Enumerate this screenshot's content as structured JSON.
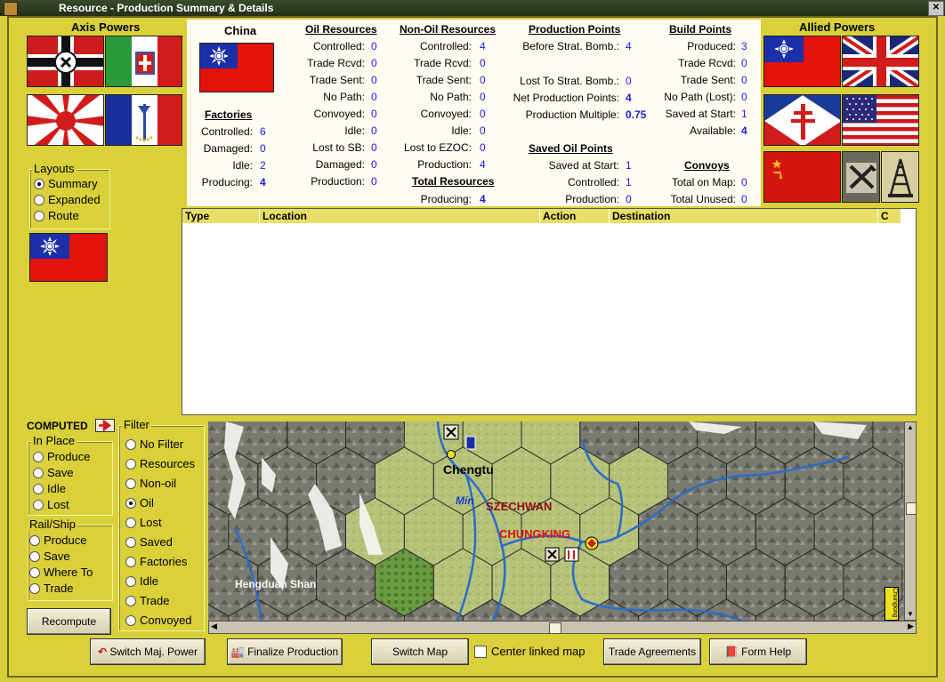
{
  "window": {
    "title": "Resource - Production Summary & Details"
  },
  "axis": {
    "header": "Axis Powers",
    "flags": [
      "Germany flag",
      "Italy flag",
      "Japan flag",
      "Vichy France flag"
    ]
  },
  "allied": {
    "header": "Allied Powers",
    "flags": [
      "China flag",
      "UK flag",
      "Free France flag",
      "USA flag",
      "USSR flag",
      "Resource icon",
      "Oil icon"
    ]
  },
  "country": {
    "name": "China"
  },
  "factories": {
    "title": "Factories",
    "rows": [
      {
        "label": "Controlled:",
        "value": "6"
      },
      {
        "label": "Damaged:",
        "value": "0"
      },
      {
        "label": "Idle:",
        "value": "2"
      },
      {
        "label": "Producing:",
        "value": "4"
      }
    ]
  },
  "oil": {
    "title": "Oil Resources",
    "rows": [
      {
        "label": "Controlled:",
        "value": "0"
      },
      {
        "label": "Trade Rcvd:",
        "value": "0"
      },
      {
        "label": "Trade Sent:",
        "value": "0"
      },
      {
        "label": "No Path:",
        "value": "0"
      },
      {
        "label": "Convoyed:",
        "value": "0"
      },
      {
        "label": "Idle:",
        "value": "0"
      },
      {
        "label": "Lost to SB:",
        "value": "0"
      },
      {
        "label": "Damaged:",
        "value": "0"
      },
      {
        "label": "Production:",
        "value": "0"
      }
    ]
  },
  "nonoil": {
    "title": "Non-Oil Resources",
    "rows": [
      {
        "label": "Controlled:",
        "value": "4"
      },
      {
        "label": "Trade Rcvd:",
        "value": "0"
      },
      {
        "label": "Trade Sent:",
        "value": "0"
      },
      {
        "label": "No Path:",
        "value": "0"
      },
      {
        "label": "Convoyed:",
        "value": "0"
      },
      {
        "label": "Idle:",
        "value": "0"
      },
      {
        "label": "Lost to EZOC:",
        "value": "0"
      },
      {
        "label": "Production:",
        "value": "4"
      }
    ],
    "total_title": "Total Resources",
    "total": {
      "label": "Producing:",
      "value": "4"
    }
  },
  "pp": {
    "title": "Production Points",
    "before": {
      "label": "Before Strat. Bomb.:",
      "value": "4"
    },
    "lost": {
      "label": "Lost To Strat. Bomb.:",
      "value": "0"
    },
    "net": {
      "label": "Net Production Points:",
      "value": "4"
    },
    "mult": {
      "label": "Production Multiple:",
      "value": "0.75"
    }
  },
  "saved_oil": {
    "title": "Saved Oil Points",
    "rows": [
      {
        "label": "Saved at Start:",
        "value": "1"
      },
      {
        "label": "Controlled:",
        "value": "1"
      },
      {
        "label": "Production:",
        "value": "0"
      }
    ]
  },
  "build": {
    "title": "Build Points",
    "rows": [
      {
        "label": "Produced:",
        "value": "3"
      },
      {
        "label": "Trade Rcvd:",
        "value": "0"
      },
      {
        "label": "Trade Sent:",
        "value": "0"
      },
      {
        "label": "No Path (Lost):",
        "value": "0"
      },
      {
        "label": "Saved at Start:",
        "value": "1"
      },
      {
        "label": "Available:",
        "value": "4"
      }
    ]
  },
  "convoys": {
    "title": "Convoys",
    "rows": [
      {
        "label": "Total on Map:",
        "value": "0"
      },
      {
        "label": "Total Unused:",
        "value": "0"
      }
    ]
  },
  "layouts": {
    "title": "Layouts",
    "options": [
      "Summary",
      "Expanded",
      "Route"
    ],
    "selected": "Summary"
  },
  "table": {
    "columns": [
      "Type",
      "Location",
      "Action",
      "Destination",
      "C"
    ]
  },
  "computed": {
    "label": "COMPUTED"
  },
  "inplace": {
    "title": "In Place",
    "options": [
      "Produce",
      "Save",
      "Idle",
      "Lost"
    ]
  },
  "railship": {
    "title": "Rail/Ship",
    "options": [
      "Produce",
      "Save",
      "Where To",
      "Trade"
    ]
  },
  "filter": {
    "title": "Filter",
    "options": [
      "No Filter",
      "Resources",
      "Non-oil",
      "Oil",
      "Lost",
      "Saved",
      "Factories",
      "Idle",
      "Trade",
      "Convoyed"
    ],
    "selected": "Oil"
  },
  "recompute_label": "Recompute",
  "map": {
    "labels": {
      "chengtu": "Chengtu",
      "min": "Min",
      "szechwan": "SZECHWAN",
      "chungking": "CHUNGKING",
      "hengduan": "Hengduan Shan",
      "side": "Chungking"
    }
  },
  "buttons": {
    "switch_major": "Switch Maj. Power",
    "finalize": "Finalize Production",
    "switch_map": "Switch Map",
    "center_linked": "Center linked map",
    "trade": "Trade Agreements",
    "form_help": "Form Help"
  },
  "colors": {
    "bg": "#d9d03a",
    "value": "#1a1ae0",
    "china_red": "#e3120b",
    "china_blue": "#1a2fa8"
  }
}
